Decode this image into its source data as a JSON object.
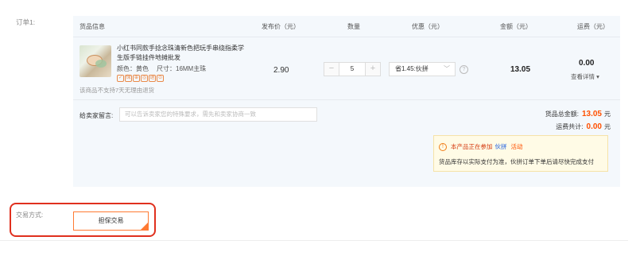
{
  "order": {
    "label": "订单1:"
  },
  "columns": {
    "goods": "货品信息",
    "price": "发布价（元）",
    "qty": "数量",
    "promo": "优惠（元）",
    "amount": "金额（元）",
    "shipping": "运费（元）"
  },
  "item": {
    "title": "小红书同款手捻念珠清新色把玩手串绕指柔学生版手链挂件地摊批发",
    "color_label": "颜色：黄色",
    "size_label": "尺寸：16MM主珠",
    "no_return": "该商品不支持7天无理由退货",
    "price": "2.90",
    "qty_minus": "−",
    "quantity": "5",
    "qty_plus": "+",
    "promo": "省1.45:伙拼",
    "promo_chevron": "﹀",
    "help": "?",
    "amount": "13.05",
    "shipping": "0.00",
    "detail_link": "查看详情 ▾",
    "service_badges": [
      "✓",
      "保",
      "⊕",
      "◎",
      "退",
      "⊙"
    ],
    "badge_color": "#e98a4a"
  },
  "note": {
    "label": "给卖家留言:",
    "placeholder": "可以告诉卖家您的特殊要求，需先和卖家协商一致"
  },
  "summary": {
    "goods_total_label": "货品总金额:",
    "goods_total": "13.05",
    "shipping_total_label": "运费共计:",
    "shipping_total": "0.00",
    "unit": "元"
  },
  "notice": {
    "icon": "!",
    "prefix": "本产品正在参加",
    "link": "伙拼",
    "suffix": "活动",
    "text": "货品库存以实际支付为准，伙拼订单下单后请尽快完成支付"
  },
  "trade": {
    "label": "交易方式:",
    "option": "担保交易"
  },
  "colors": {
    "accent": "#ff5000",
    "highlight_frame": "#e0301e",
    "link_blue": "#1f5fe0",
    "panel_bg": "#f4f8fc"
  }
}
